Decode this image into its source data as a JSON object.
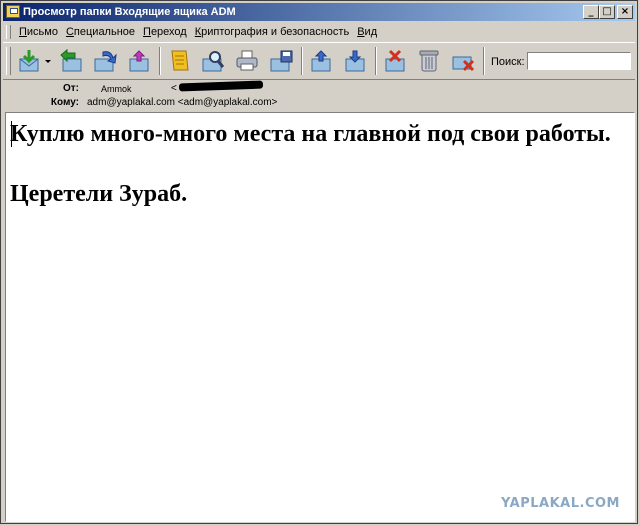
{
  "window": {
    "title": "Просмотр папки Входящие ящика ADM",
    "minimize_glyph": "_",
    "maximize_glyph": "□",
    "close_glyph": "×"
  },
  "menu": {
    "items": [
      {
        "label": "Письмо",
        "accel": "П",
        "rest": "исьмо"
      },
      {
        "label": "Специальное",
        "accel": "С",
        "rest": "пециальное"
      },
      {
        "label": "Переход",
        "accel": "П",
        "rest": "ереход"
      },
      {
        "label": "Криптография и безопасность",
        "accel": "К",
        "rest": "риптография и безопасность"
      },
      {
        "label": "Вид",
        "accel": "В",
        "rest": "ид"
      }
    ]
  },
  "toolbar": {
    "icons": [
      "get-mail-icon",
      "dropdown-arrow-icon",
      "reply-all-icon",
      "forward-icon",
      "move-icon",
      "note-icon",
      "find-icon",
      "print-icon",
      "save-icon",
      "prev-message-icon",
      "next-message-icon",
      "junk-icon",
      "trash-icon",
      "delete-icon"
    ],
    "search_label": "Поиск:",
    "search_value": ""
  },
  "message": {
    "from_label": "От:",
    "from_name": "Ammok",
    "from_bracket": "<",
    "to_label": "Кому:",
    "to_value": "adm@yaplakal.com <adm@yaplakal.com>",
    "body_line1": "Куплю много-много места на главной под свои работы.",
    "body_line2": "Церетели Зураб."
  },
  "watermark": "YAPLAKAL.COM",
  "colors": {
    "title_start": "#0a246a",
    "title_end": "#a6caf0",
    "chrome": "#d4d0c8",
    "watermark": "#8aa8c4"
  }
}
